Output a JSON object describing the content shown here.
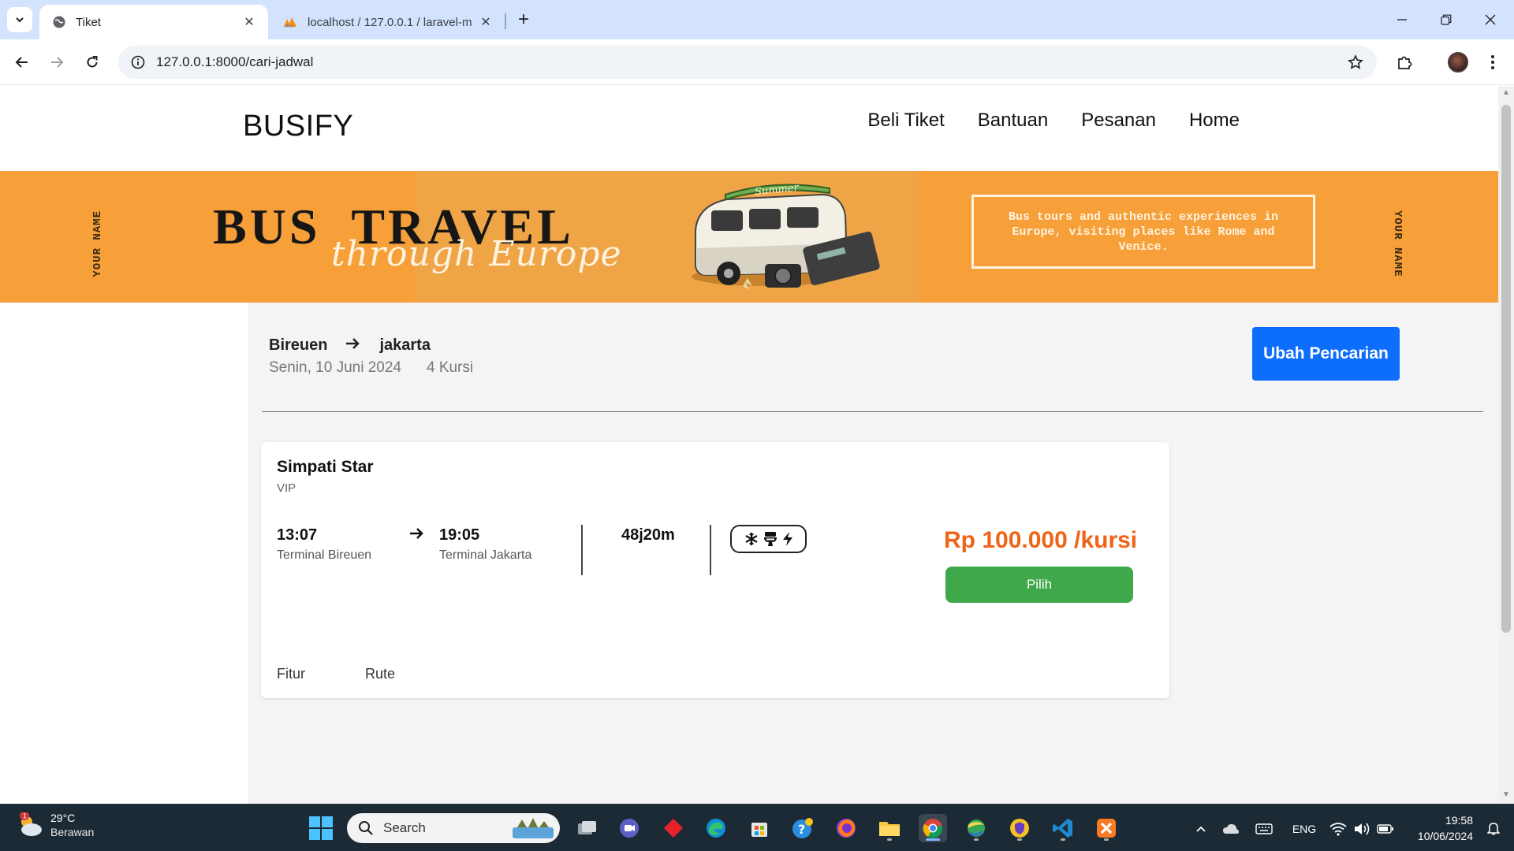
{
  "browser": {
    "tabs": [
      {
        "title": "Tiket",
        "active": true
      },
      {
        "title": "localhost / 127.0.0.1 / laravel-m",
        "active": false
      }
    ],
    "url": "127.0.0.1:8000/cari-jadwal"
  },
  "site": {
    "brand": "BUSIFY",
    "nav": [
      "Beli Tiket",
      "Bantuan",
      "Pesanan",
      "Home"
    ]
  },
  "banner": {
    "side_left": "YOUR NAME",
    "side_right": "YOUR NAME",
    "title": "BUS  TRAVEL",
    "script": "through Europe",
    "van_label": "Summer",
    "promo": "Bus tours and authentic experiences in Europe, visiting places like Rome and Venice.",
    "colors": {
      "background": "#f7a03a",
      "text": "#161616",
      "accent": "#fff3df"
    }
  },
  "search": {
    "origin": "Bireuen",
    "destination": "jakarta",
    "date": "Senin, 10 Juni 2024",
    "seats": "4 Kursi",
    "change_button": "Ubah Pencarian"
  },
  "results": [
    {
      "operator": "Simpati Star",
      "class": "VIP",
      "depart_time": "13:07",
      "depart_terminal": "Terminal Bireuen",
      "arrive_time": "19:05",
      "arrive_terminal": "Terminal Jakarta",
      "duration": "48j20m",
      "facilities": [
        "snowflake-icon",
        "toilet-icon",
        "bolt-icon"
      ],
      "price": "Rp 100.000 /kursi",
      "select_button": "Pilih",
      "tabs": [
        "Fitur",
        "Rute"
      ]
    }
  ],
  "taskbar": {
    "weather_temp": "29°C",
    "weather_cond": "Berawan",
    "weather_badge": "1",
    "search_label": "Search",
    "language": "ENG",
    "time": "19:58",
    "date": "10/06/2024"
  },
  "colors": {
    "primary_button": "#0d6efd",
    "select_button": "#3fa84a",
    "price": "#f06418"
  }
}
